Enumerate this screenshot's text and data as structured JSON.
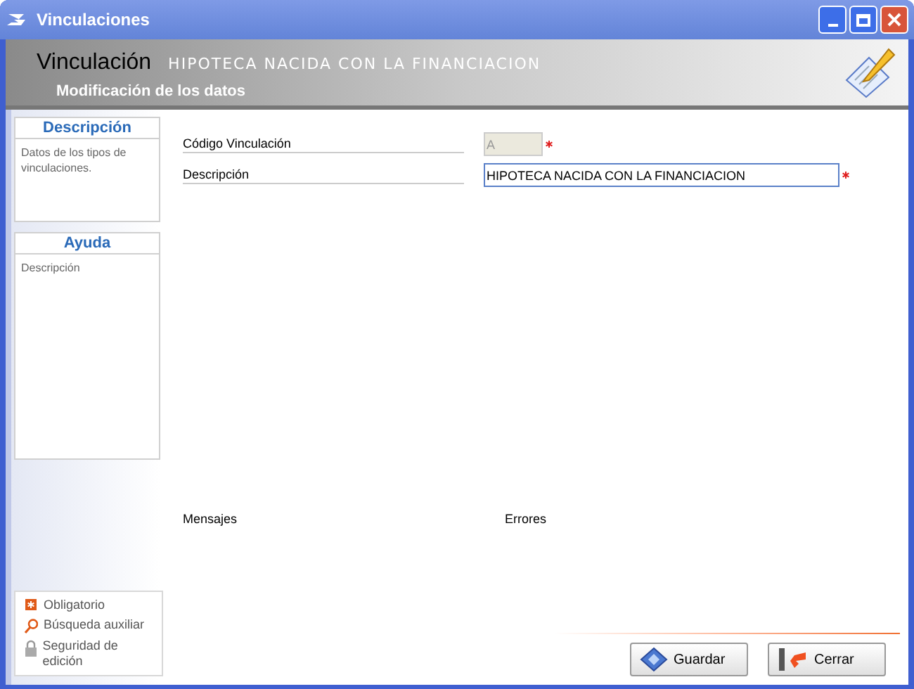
{
  "window": {
    "title": "Vinculaciones"
  },
  "header": {
    "title": "Vinculación",
    "record": "HIPOTECA NACIDA CON LA FINANCIACION",
    "subtitle": "Modificación de los datos"
  },
  "side_panels": [
    {
      "title": "Descripción",
      "text": "Datos de los tipos de vinculaciones."
    },
    {
      "title": "Ayuda",
      "text": "Descripción"
    }
  ],
  "fields": [
    {
      "label": "Código Vinculación",
      "value": "A",
      "disabled": true,
      "required": true
    },
    {
      "label": "Descripción",
      "value": "HIPOTECA NACIDA CON LA FINANCIACION",
      "disabled": false,
      "required": true
    }
  ],
  "sections": [
    "Mensajes",
    "Errores"
  ],
  "legend": [
    {
      "kind": "required",
      "label": "Obligatorio"
    },
    {
      "kind": "search",
      "label": "Búsqueda auxiliar"
    },
    {
      "kind": "lock",
      "label": "Seguridad de edición"
    }
  ],
  "buttons": [
    {
      "kind": "save",
      "label": "Guardar"
    },
    {
      "kind": "close",
      "label": "Cerrar"
    }
  ]
}
